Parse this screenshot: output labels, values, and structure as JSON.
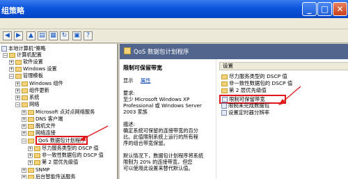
{
  "window": {
    "title": "组策略"
  },
  "tree": {
    "items": [
      {
        "label": "本地计算机\"策略",
        "depth": 0,
        "type": "root"
      },
      {
        "label": "计算机配置",
        "depth": 1,
        "type": "folder",
        "expanded": true
      },
      {
        "label": "软件设置",
        "depth": 2,
        "type": "folder"
      },
      {
        "label": "Windows 设置",
        "depth": 2,
        "type": "folder"
      },
      {
        "label": "管理模板",
        "depth": 2,
        "type": "folder",
        "expanded": true
      },
      {
        "label": "Windows 组件",
        "depth": 3,
        "type": "folder"
      },
      {
        "label": "组件更新",
        "depth": 3,
        "type": "folder"
      },
      {
        "label": "系统",
        "depth": 3,
        "type": "folder"
      },
      {
        "label": "网络",
        "depth": 3,
        "type": "folder",
        "expanded": true
      },
      {
        "label": "Microsoft 点对点网络服务",
        "depth": 4,
        "type": "folder"
      },
      {
        "label": "DNS 客户端",
        "depth": 4,
        "type": "folder"
      },
      {
        "label": "脱机文件",
        "depth": 4,
        "type": "folder"
      },
      {
        "label": "网络连接",
        "depth": 4,
        "type": "folder"
      },
      {
        "label": "QoS 数据包计划程序",
        "depth": 4,
        "type": "folder",
        "expanded": true,
        "highlighted": true
      },
      {
        "label": "尽力服务类型的 DSCP 值",
        "depth": 5,
        "type": "folder"
      },
      {
        "label": "非一致性数据包的 DSCP 值",
        "depth": 5,
        "type": "folder"
      },
      {
        "label": "第 2 层优先级值",
        "depth": 5,
        "type": "folder"
      },
      {
        "label": "SNMP",
        "depth": 4,
        "type": "folder"
      },
      {
        "label": "后台智能传送服务",
        "depth": 4,
        "type": "folder"
      }
    ]
  },
  "pane": {
    "title": "QoS 数据包计划程序",
    "setting_name": "限制可保留带宽",
    "show_label": "显示",
    "properties_link": "属性",
    "requirements_label": "要求:",
    "requirements_text": [
      "至少 Microsoft Windows XP",
      "Professional 或 Windows Server",
      "2003 家族"
    ],
    "description_label": "描述:",
    "description_text": [
      "确定系统可保留的连接带宽的百分",
      "比。此值限制系统上运行的所有程",
      "序的组合带宽保留。"
    ],
    "default_text": [
      "默认情况下，数据包计划程序将系统",
      "限制为 20% 的连接带宽，但您",
      "可以使用此设置来替代默认值。"
    ]
  },
  "list": {
    "header": "设置",
    "items": [
      {
        "label": "尽力服务类型的 DSCP 值",
        "type": "folder"
      },
      {
        "label": "非一致性数据包的 DSCP 值",
        "type": "folder"
      },
      {
        "label": "第 2 层优先级值",
        "type": "folder"
      },
      {
        "label": "限制可保留带宽",
        "type": "policy",
        "highlighted": true
      },
      {
        "label": "限制未完成数据包",
        "type": "policy"
      },
      {
        "label": "设置定时器分辨率",
        "type": "policy"
      }
    ]
  }
}
